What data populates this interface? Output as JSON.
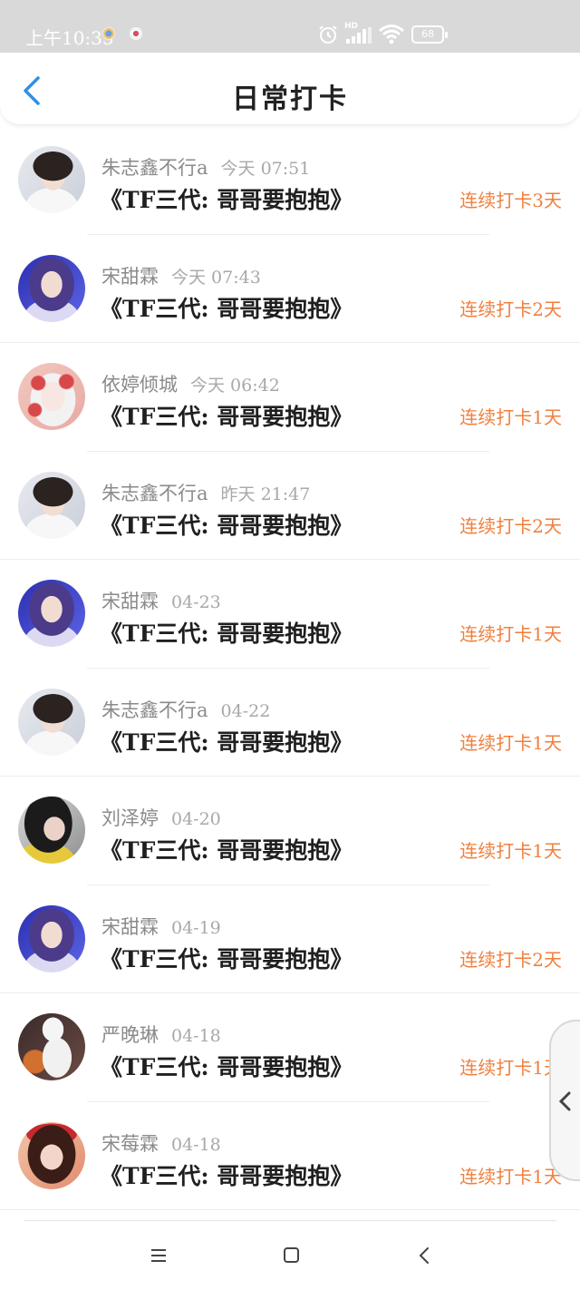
{
  "status_bar": {
    "time": "上午10:35",
    "hd_label": "HD",
    "battery": "68",
    "icons": [
      "notification-app-icon",
      "notification-app-icon",
      "alarm-icon",
      "signal-icon",
      "wifi-icon",
      "battery-icon"
    ]
  },
  "header": {
    "title": "日常打卡",
    "back_icon": "chevron-left-icon"
  },
  "colors": {
    "accent": "#2f8fe6",
    "streak": "#f07f3c",
    "title_text": "#1f1f1f",
    "meta_text": "#8a8a8a",
    "status_bar_bg": "#d9d9d9"
  },
  "records": [
    {
      "name": "朱志鑫不行a",
      "time": "今天 07:51",
      "title": "《TF三代: 哥哥要抱抱》",
      "streak": "连续打卡3天",
      "avatar": "boy"
    },
    {
      "name": "宋甜霖",
      "time": "今天 07:43",
      "title": "《TF三代: 哥哥要抱抱》",
      "streak": "连续打卡2天",
      "avatar": "blue"
    },
    {
      "name": "依婷倾城",
      "time": "今天 06:42",
      "title": "《TF三代: 哥哥要抱抱》",
      "streak": "连续打卡1天",
      "avatar": "flower"
    },
    {
      "name": "朱志鑫不行a",
      "time": "昨天 21:47",
      "title": "《TF三代: 哥哥要抱抱》",
      "streak": "连续打卡2天",
      "avatar": "boy"
    },
    {
      "name": "宋甜霖",
      "time": "04-23",
      "title": "《TF三代: 哥哥要抱抱》",
      "streak": "连续打卡1天",
      "avatar": "blue"
    },
    {
      "name": "朱志鑫不行a",
      "time": "04-22",
      "title": "《TF三代: 哥哥要抱抱》",
      "streak": "连续打卡1天",
      "avatar": "boy"
    },
    {
      "name": "刘泽婷",
      "time": "04-20",
      "title": "《TF三代: 哥哥要抱抱》",
      "streak": "连续打卡1天",
      "avatar": "girl"
    },
    {
      "name": "宋甜霖",
      "time": "04-19",
      "title": "《TF三代: 哥哥要抱抱》",
      "streak": "连续打卡2天",
      "avatar": "blue"
    },
    {
      "name": "严晚琳",
      "time": "04-18",
      "title": "《TF三代: 哥哥要抱抱》",
      "streak": "连续打卡1天",
      "avatar": "room"
    },
    {
      "name": "宋莓霖",
      "time": "04-18",
      "title": "《TF三代: 哥哥要抱抱》",
      "streak": "连续打卡1天",
      "avatar": "red"
    }
  ],
  "side_handle": {
    "icon": "chevron-left-icon"
  },
  "nav_bar": {
    "icons": [
      "menu-icon",
      "home-square-icon",
      "back-icon"
    ]
  }
}
